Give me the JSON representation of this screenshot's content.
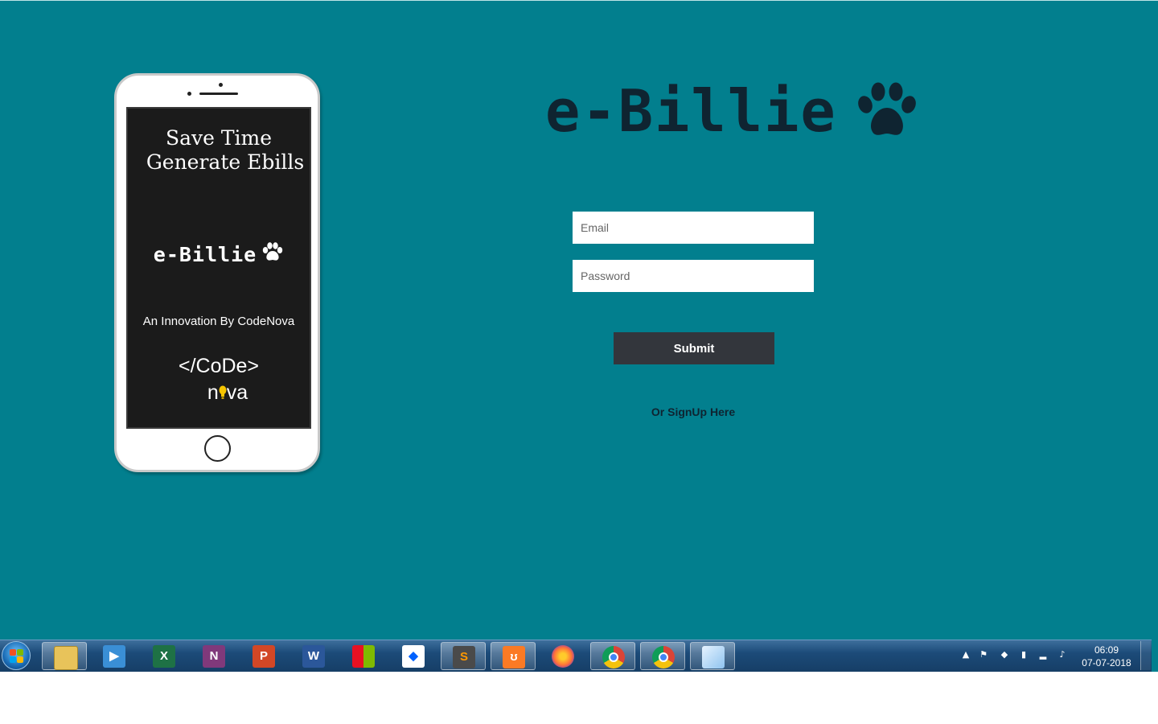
{
  "phone": {
    "slogan_line1": "Save Time",
    "slogan_line2": "Generate Ebills",
    "brand": "e-Billie",
    "innovation": "An Innovation By CodeNova",
    "code_line": "</CoDe>",
    "nova_start": "n",
    "nova_end": "va"
  },
  "brand": {
    "name": "e-Billie",
    "icon": "paw-icon"
  },
  "form": {
    "email_placeholder": "Email",
    "password_placeholder": "Password",
    "submit_label": "Submit",
    "signup_link": "Or SignUp Here"
  },
  "taskbar": {
    "apps": [
      "file-explorer",
      "media-player",
      "excel",
      "onenote",
      "powerpoint",
      "word",
      "windows-store",
      "dropbox",
      "sublime-text",
      "xampp",
      "firefox",
      "chrome",
      "chrome",
      "notepad"
    ],
    "clock_time": "06:09",
    "clock_date": "07-07-2018"
  },
  "colors": {
    "background": "#027f8e",
    "brand": "#0f2431",
    "submit": "#33363c"
  }
}
